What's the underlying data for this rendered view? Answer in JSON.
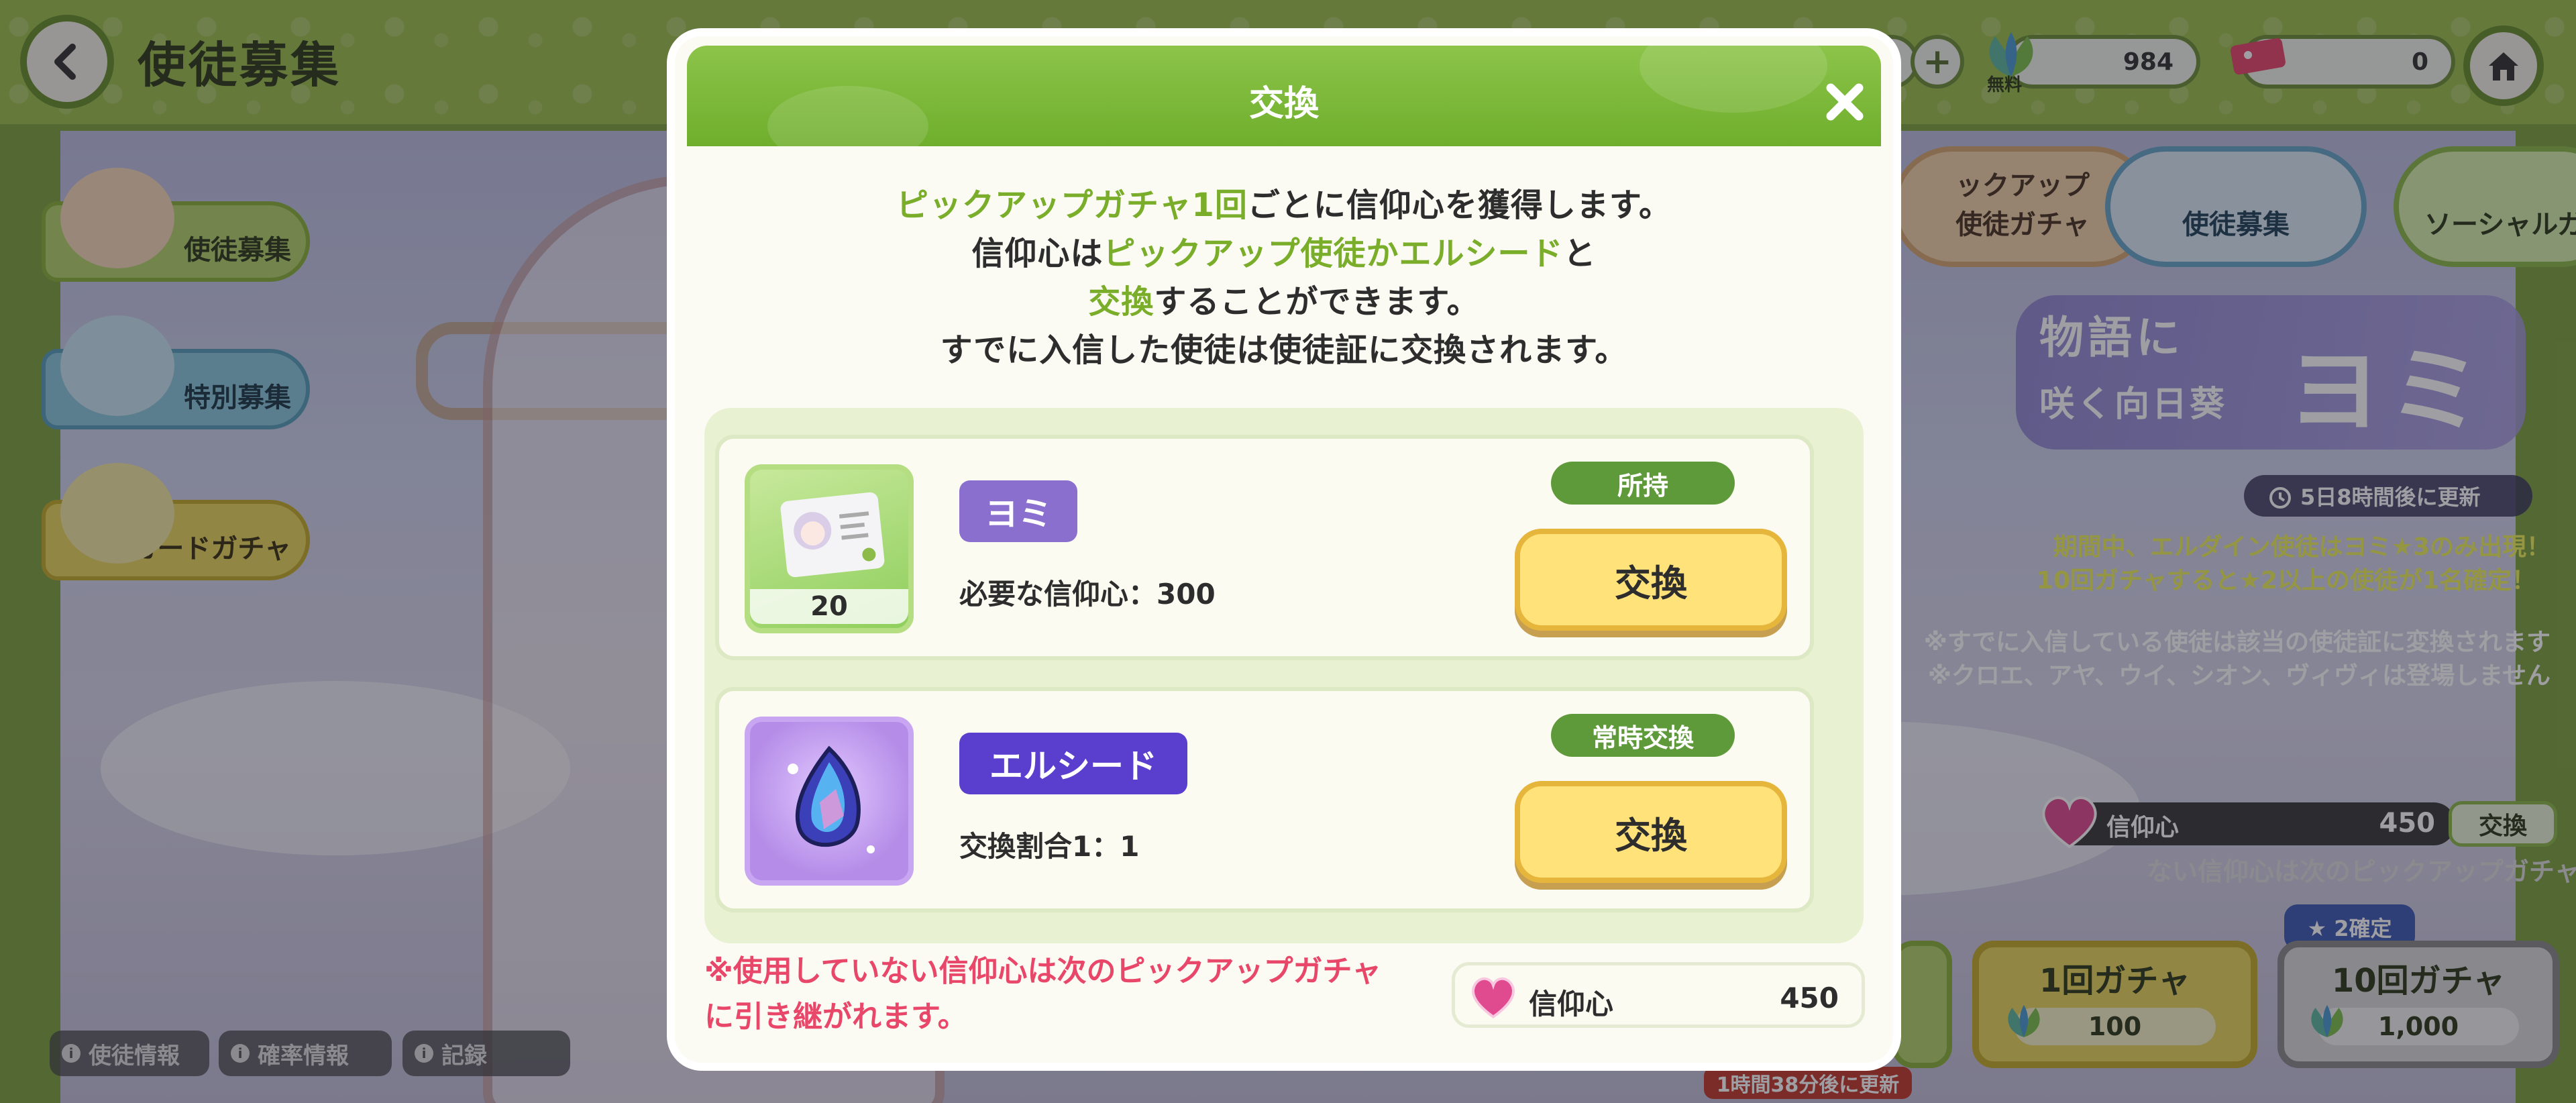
{
  "header": {
    "page_title": "使徒募集",
    "resources": {
      "first_value": "0",
      "free_label": "無料",
      "free_value": "984",
      "ticket_value": "0"
    }
  },
  "side_nav": {
    "items": [
      {
        "label": "使徒募集"
      },
      {
        "label": "特別募集"
      },
      {
        "label": "カードガチャ"
      }
    ]
  },
  "right_tabs": [
    {
      "label": "ックアップ\n使徒ガチャ"
    },
    {
      "label": "使徒募集"
    },
    {
      "label": "ソーシャルガ"
    }
  ],
  "banner": {
    "title_line1": "物語に",
    "title_line2": "咲く向日葵",
    "character": "ヨミ"
  },
  "event": {
    "timer_label": "5日8時間後に更新",
    "line1": "期間中、エルダイン使徒はヨミ★3のみ出現！",
    "line2": "10回ガチャすると★2以上の使徒が1名確定！",
    "line3": "※すでに入信している使徒は該当の使徒証に変換されます",
    "line4": "※クロエ、アヤ、ウイ、シオン、ヴィヴィは登場しません"
  },
  "faith_bar": {
    "label": "信仰心",
    "value": "450",
    "exchange_label": "交換",
    "carry_text": "ない信仰心は次のピックアップガチャに引き継がれます。"
  },
  "gacha": {
    "guarantee_label": "★ 2確定",
    "single": {
      "label": "1回ガチャ",
      "cost": "100"
    },
    "ten": {
      "label": "10回ガチャ",
      "cost": "1,000"
    },
    "remaining_label": "1時間38分後に更新"
  },
  "bottom_chips": [
    {
      "label": "使徒情報"
    },
    {
      "label": "確率情報"
    },
    {
      "label": "記録"
    }
  ],
  "modal": {
    "title": "交換",
    "desc_line1_a": "ピックアップガチャ1回",
    "desc_line1_b": "ごとに信仰心を獲得します。",
    "desc_line2_a": "信仰心は",
    "desc_line2_b": "ピックアップ使徒かエルシード",
    "desc_line2_c": "と",
    "desc_line3_a": "交換",
    "desc_line3_b": "することができます。",
    "desc_line4": "すでに入信した使徒は使徒証に交換されます。",
    "items": [
      {
        "name": "ヨミ",
        "sub": "必要な信仰心：300",
        "count": "20",
        "status": "所持",
        "button": "交換"
      },
      {
        "name": "エルシード",
        "sub": "交換割合1：1",
        "status": "常時交換",
        "button": "交換"
      }
    ],
    "note_line1": "※使用していない信仰心は次のピックアップガチャ",
    "note_line2": "に引き継がれます。",
    "faith_label": "信仰心",
    "faith_value": "450"
  },
  "colors": {
    "accent_green": "#79ad2a",
    "header_green": "#6fae2c",
    "warning_pink": "#e8476a",
    "button_yellow": "#ffe27a",
    "tag_purple": "#8a6fcf",
    "tag_indigo": "#5a3fcf"
  },
  "icons": [
    "back-icon",
    "plus-icon",
    "leaf-icon",
    "ticket-icon",
    "home-icon",
    "close-icon",
    "heart-icon",
    "alarm-icon",
    "gem-icon",
    "info-icon"
  ]
}
